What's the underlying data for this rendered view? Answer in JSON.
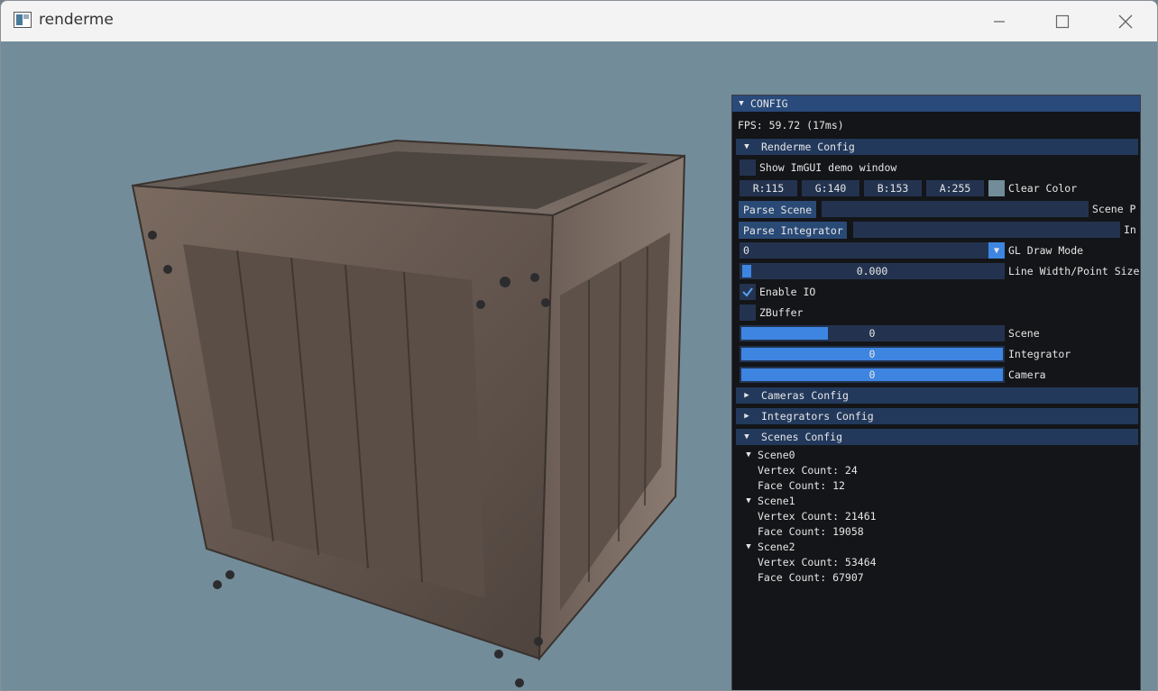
{
  "window": {
    "title": "renderme"
  },
  "panel": {
    "title": "CONFIG",
    "fps": "FPS: 59.72 (17ms)",
    "renderme_config": {
      "header": "Renderme Config",
      "show_demo_label": "Show ImGUI demo window",
      "color": {
        "r": "R:115",
        "g": "G:140",
        "b": "B:153",
        "a": "A:255",
        "label": "Clear Color",
        "swatch": "#738c99"
      },
      "parse_scene_button": "Parse Scene",
      "scene_path_label": "Scene P",
      "parse_integrator_button": "Parse Integrator",
      "integrator_path_label": "In",
      "draw_mode": {
        "value": "0",
        "label": "GL Draw Mode"
      },
      "line_width": {
        "value": "0.000",
        "label": "Line Width/Point Size",
        "fill": 0.0
      },
      "enable_io": {
        "label": "Enable IO",
        "checked": true
      },
      "zbuffer": {
        "label": "ZBuffer",
        "checked": false
      },
      "sliders": [
        {
          "value": "0",
          "label": "Scene",
          "fill": 0.33
        },
        {
          "value": "0",
          "label": "Integrator",
          "fill": 1.0
        },
        {
          "value": "0",
          "label": "Camera",
          "fill": 1.0
        }
      ]
    },
    "cameras_config": "Cameras Config",
    "integrators_config": "Integrators Config",
    "scenes_config": {
      "header": "Scenes Config",
      "scenes": [
        {
          "name": "Scene0",
          "vertex": "Vertex Count: 24",
          "face": "Face Count: 12"
        },
        {
          "name": "Scene1",
          "vertex": "Vertex Count: 21461",
          "face": "Face Count: 19058"
        },
        {
          "name": "Scene2",
          "vertex": "Vertex Count: 53464",
          "face": "Face Count: 67907"
        }
      ]
    }
  },
  "colors": {
    "accent": "#3d85e0",
    "panel_bg": "#141518",
    "header": "#294a7a",
    "viewport_bg": "#738c99"
  }
}
